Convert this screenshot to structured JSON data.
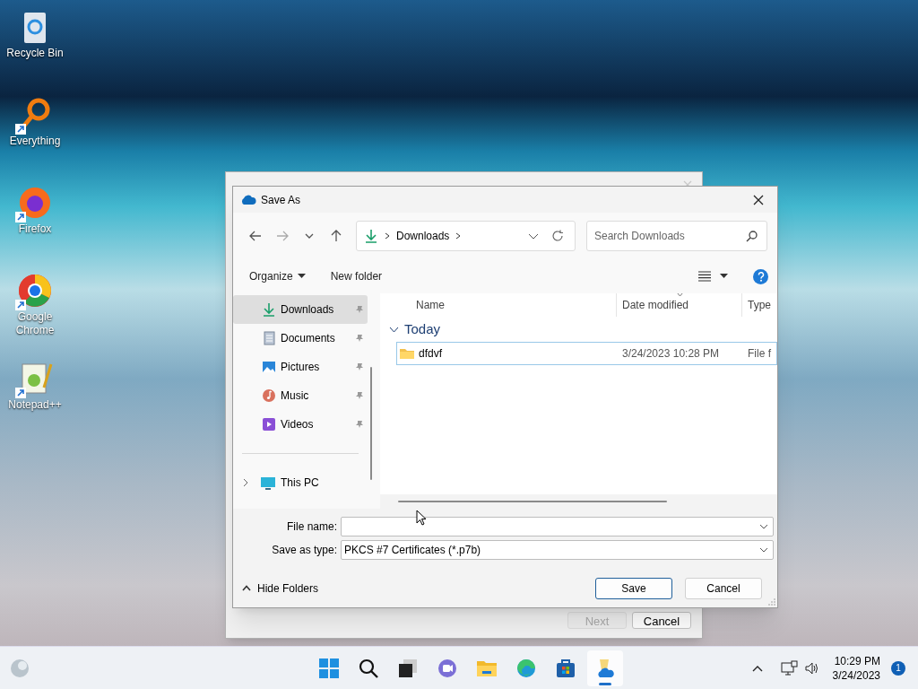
{
  "desktop_icons": [
    {
      "label": "Recycle Bin",
      "kind": "recycle",
      "shortcut": false
    },
    {
      "label": "Everything",
      "kind": "everything",
      "shortcut": true
    },
    {
      "label": "Firefox",
      "kind": "firefox",
      "shortcut": true
    },
    {
      "label": "Google Chrome",
      "kind": "chrome",
      "shortcut": true
    },
    {
      "label": "Notepad++",
      "kind": "notepad",
      "shortcut": true
    }
  ],
  "background_window": {
    "buttons": [
      {
        "label": "Next",
        "disabled": true
      },
      {
        "label": "Cancel",
        "disabled": false
      }
    ]
  },
  "dialog": {
    "title": "Save As",
    "address": {
      "location": "Downloads"
    },
    "search": {
      "placeholder": "Search Downloads"
    },
    "toolbar": {
      "organize": "Organize",
      "new_folder": "New folder"
    },
    "sidebar": {
      "items": [
        {
          "label": "Downloads",
          "kind": "downloads",
          "selected": true,
          "pinned": true
        },
        {
          "label": "Documents",
          "kind": "documents",
          "selected": false,
          "pinned": true
        },
        {
          "label": "Pictures",
          "kind": "pictures",
          "selected": false,
          "pinned": true
        },
        {
          "label": "Music",
          "kind": "music",
          "selected": false,
          "pinned": true
        },
        {
          "label": "Videos",
          "kind": "videos",
          "selected": false,
          "pinned": true
        },
        {
          "label": "This PC",
          "kind": "pc",
          "selected": false,
          "pinned": false
        }
      ]
    },
    "columns": [
      "Name",
      "Date modified",
      "Type"
    ],
    "group": {
      "label": "Today",
      "expanded": true
    },
    "rows": [
      {
        "name": "dfdvf",
        "date": "3/24/2023 10:28 PM",
        "type": "File f",
        "selected": true
      }
    ],
    "file_name_label": "File name:",
    "save_type_label": "Save as type:",
    "save_type_value": "PKCS #7 Certificates (*.p7b)",
    "hide_folders": "Hide Folders",
    "buttons": [
      "Save",
      "Cancel"
    ]
  },
  "taskbar": {
    "apps": [
      {
        "kind": "start",
        "selected": false
      },
      {
        "kind": "search",
        "selected": false
      },
      {
        "kind": "taskview",
        "selected": false
      },
      {
        "kind": "chat",
        "selected": false
      },
      {
        "kind": "explorer",
        "selected": false
      },
      {
        "kind": "edge",
        "selected": false
      },
      {
        "kind": "store",
        "selected": false
      },
      {
        "kind": "certmgr",
        "selected": true
      }
    ],
    "time": "10:29 PM",
    "date": "3/24/2023",
    "notifications": "1"
  }
}
